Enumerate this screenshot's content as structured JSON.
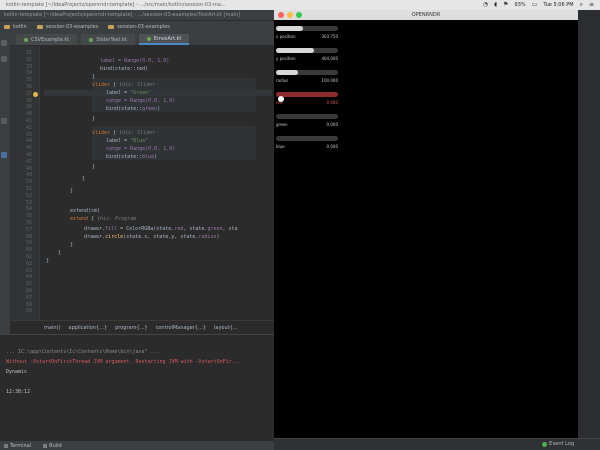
{
  "menubar": {
    "left_text": "kotlin-template [~/IdeaProjects/openrndr-template] - .../src/main/kotlin/session-03-ma...",
    "battery": "93%",
    "clock": "Tue 5:06 PM",
    "icons": [
      "wifi-icon",
      "volume-icon",
      "flag-icon",
      "battery-icon",
      "clock-icon",
      "search-icon",
      "menu-icon"
    ]
  },
  "ide": {
    "title": "kotlin-template [~/IdeaProjects/openrndr-template] - .../session-03-examples/TestArt.kt [main]",
    "nav": [
      "kotlin",
      "session-03-examples",
      "session-03-examples"
    ],
    "tabs": [
      {
        "label": "CSVExample.kt",
        "active": false
      },
      {
        "label": "SliderTest.kt",
        "active": false
      },
      {
        "label": "EmosArt.kt",
        "active": true
      }
    ],
    "line_numbers": [
      "31",
      "32",
      "33",
      "34",
      "35",
      "36",
      "37",
      "38",
      "39",
      "40",
      "41",
      "42",
      "43",
      "44",
      "45",
      "46",
      "47",
      "48",
      "49",
      "50",
      "51",
      "52",
      "53",
      "54",
      "55",
      "56",
      "57",
      "58",
      "59",
      "60",
      "61",
      "62",
      "63",
      "64",
      "65",
      "66",
      "67",
      "68",
      "69"
    ],
    "breadcrumbs": [
      "main()",
      "application{...}",
      "program{...}",
      "controlManager{...}",
      "layout{..."
    ],
    "console": {
      "line1": "... IC:\\app\\Contents\\Ic\\Contents\\Home\\bin\\java\" ...",
      "line2": "Without -XstartOnFirstThread JVM argument. Restarting JVM with -XstartOnFir...",
      "line3": "Dynamic",
      "line4": "12:38:12"
    },
    "status": [
      "Terminal",
      "Build"
    ]
  },
  "code": {
    "l1": "label = Range(0.0, 1.0)",
    "l2": "bind(state::red)",
    "l3": "}",
    "l4_kw": "slider",
    "l4_hint": "this: Slider",
    "l5_a": "label = ",
    "l5_s": "\"Green\"",
    "l6": "range = Range(0.0, 1.0)",
    "l7_a": "bind(state::",
    "l7_p": "green",
    "l7_b": ")",
    "l8": "}",
    "l9_kw": "slider",
    "l9_hint": "this: Slider",
    "l10_a": "label = ",
    "l10_s": "\"Blue\"",
    "l11": "range = Range(0.0, 1.0)",
    "l12_a": "bind(state::",
    "l12_p": "blue",
    "l12_b": ")",
    "l13": "}",
    "l14": "}",
    "l15": "}",
    "l16": "extend(cm)",
    "l17_kw": "extend",
    "l17_hint": "this: Program",
    "l18_a": "drawer.",
    "l18_f": "fill",
    "l18_b": " = ColorRGBa(state.",
    "l18_p1": "red",
    "l18_c": ", state.",
    "l18_p2": "green",
    "l18_d": ", sta",
    "l19_a": "drawer.",
    "l19_f": "circle",
    "l19_b": "(state.x, state.y, state.",
    "l19_p": "radius",
    "l19_c": ")",
    "l20": "}",
    "l21": "}",
    "l22": "}"
  },
  "openrndr": {
    "title": "OPENRNDR",
    "sliders": [
      {
        "label": "x position",
        "value_text": "303.750",
        "fraction": 0.44,
        "active": false
      },
      {
        "label": "y position",
        "value_text": "404.000",
        "fraction": 0.62,
        "active": false
      },
      {
        "label": "radius",
        "value_text": "100.000",
        "fraction": 0.35,
        "active": false
      },
      {
        "label": "red",
        "value_text": "0.000",
        "fraction": 0.0,
        "active": true
      },
      {
        "label": "green",
        "value_text": "0.000",
        "fraction": 0.0,
        "active": false
      },
      {
        "label": "blue",
        "value_text": "0.000",
        "fraction": 0.0,
        "active": false
      }
    ]
  },
  "dock": {
    "event_log": "Event Log"
  },
  "colors": {
    "ide_bg": "#2b2b2b",
    "keyword": "#cc7832",
    "string": "#6a8759",
    "property": "#9876aa",
    "function": "#ffc66d",
    "error": "#d65b5b",
    "active_slider": "#b44242"
  }
}
